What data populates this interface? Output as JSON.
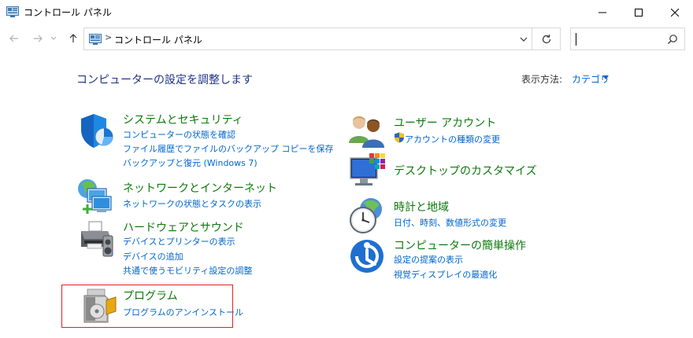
{
  "window": {
    "title": "コントロール パネル"
  },
  "address_bar": {
    "path": "コントロール パネル",
    "separator": ">"
  },
  "search": {
    "placeholder": ""
  },
  "page": {
    "heading": "コンピューターの設定を調整します",
    "view_by_label": "表示方法:",
    "view_by_value": "カテゴリ"
  },
  "categories": [
    {
      "title": "システムとセキュリティ",
      "icon": "shield-icon",
      "links": [
        "コンピューターの状態を確認",
        "ファイル履歴でファイルのバックアップ コピーを保存",
        "バックアップと復元 (Windows 7)"
      ]
    },
    {
      "title": "ネットワークとインターネット",
      "icon": "network-icon",
      "links": [
        "ネットワークの状態とタスクの表示"
      ]
    },
    {
      "title": "ハードウェアとサウンド",
      "icon": "printer-icon",
      "links": [
        "デバイスとプリンターの表示",
        "デバイスの追加",
        "共通で使うモビリティ設定の調整"
      ]
    },
    {
      "title": "プログラム",
      "icon": "programs-icon",
      "links": [
        "プログラムのアンインストール"
      ]
    },
    {
      "title": "ユーザー アカウント",
      "icon": "users-icon",
      "links": [
        "アカウントの種類の変更"
      ]
    },
    {
      "title": "デスクトップのカスタマイズ",
      "icon": "desktop-icon",
      "links": []
    },
    {
      "title": "時計と地域",
      "icon": "clock-globe-icon",
      "links": [
        "日付、時刻、数値形式の変更"
      ]
    },
    {
      "title": "コンピューターの簡単操作",
      "icon": "ease-of-access-icon",
      "links": [
        "設定の提案の表示",
        "視覚ディスプレイの最適化"
      ]
    }
  ],
  "colors": {
    "category_title": "#0b7a0b",
    "link": "#0066cc",
    "heading": "#1e3287",
    "highlight_border": "#e02020"
  }
}
